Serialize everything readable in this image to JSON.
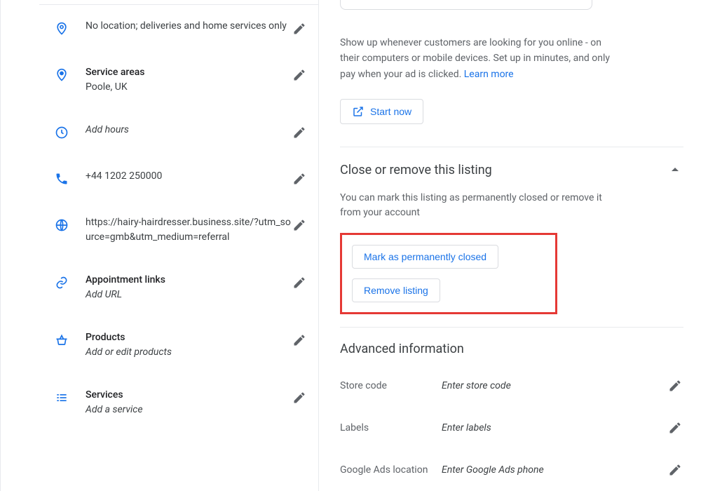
{
  "left": {
    "location": "No location; deliveries and home services only",
    "service_areas_title": "Service areas",
    "service_areas_value": "Poole, UK",
    "hours_placeholder": "Add hours",
    "phone": "+44 1202 250000",
    "website": "https://hairy-hairdresser.business.site/?utm_source=gmb&utm_medium=referral",
    "appt_title": "Appointment links",
    "appt_placeholder": "Add URL",
    "products_title": "Products",
    "products_placeholder": "Add or edit products",
    "services_title": "Services",
    "services_placeholder": "Add a service"
  },
  "ads": {
    "text": "Show up whenever customers are looking for you online - on their computers or mobile devices. Set up in minutes, and only pay when your ad is clicked. ",
    "learn_more": "Learn more",
    "start_now": "Start now"
  },
  "close_section": {
    "title": "Close or remove this listing",
    "body": "You can mark this listing as permanently closed or remove it from your account",
    "mark_closed": "Mark as permanently closed",
    "remove": "Remove listing"
  },
  "advanced": {
    "title": "Advanced information",
    "store_code_label": "Store code",
    "store_code_placeholder": "Enter store code",
    "labels_label": "Labels",
    "labels_placeholder": "Enter labels",
    "gads_label": "Google Ads location",
    "gads_placeholder": "Enter Google Ads phone"
  }
}
